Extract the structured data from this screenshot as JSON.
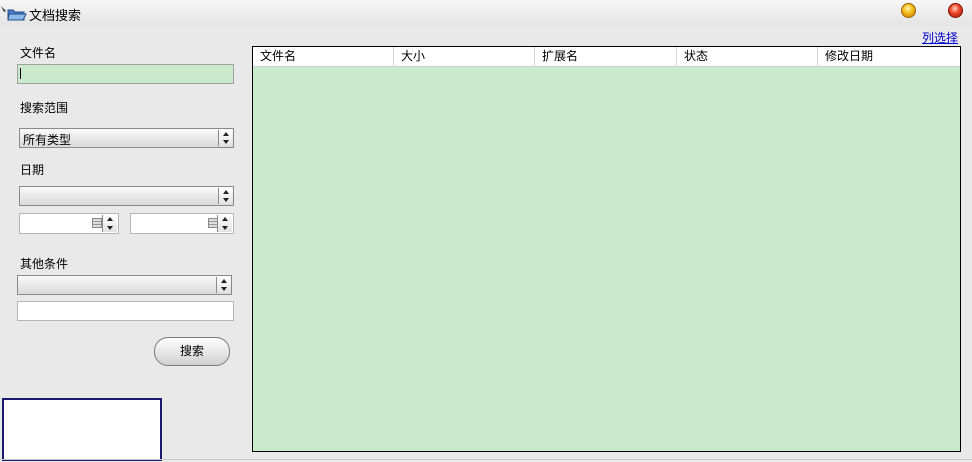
{
  "window": {
    "title": "文档搜索",
    "column_select_link": "列选择"
  },
  "search_form": {
    "filename_label": "文件名",
    "filename_value": "",
    "scope_label": "搜索范围",
    "scope_selected": "所有类型",
    "date_label": "日期",
    "date_selected": "",
    "date_from": "",
    "date_to": "",
    "other_label": "其他条件",
    "other_selected": "",
    "other_value": "",
    "search_button": "搜索"
  },
  "results_table": {
    "columns": [
      "文件名",
      "大小",
      "扩展名",
      "状态",
      "修改日期"
    ],
    "rows": []
  },
  "colors": {
    "accent_green": "#c9ebcc",
    "link_blue": "#0000cc",
    "panel_border": "#1a1a6e"
  }
}
